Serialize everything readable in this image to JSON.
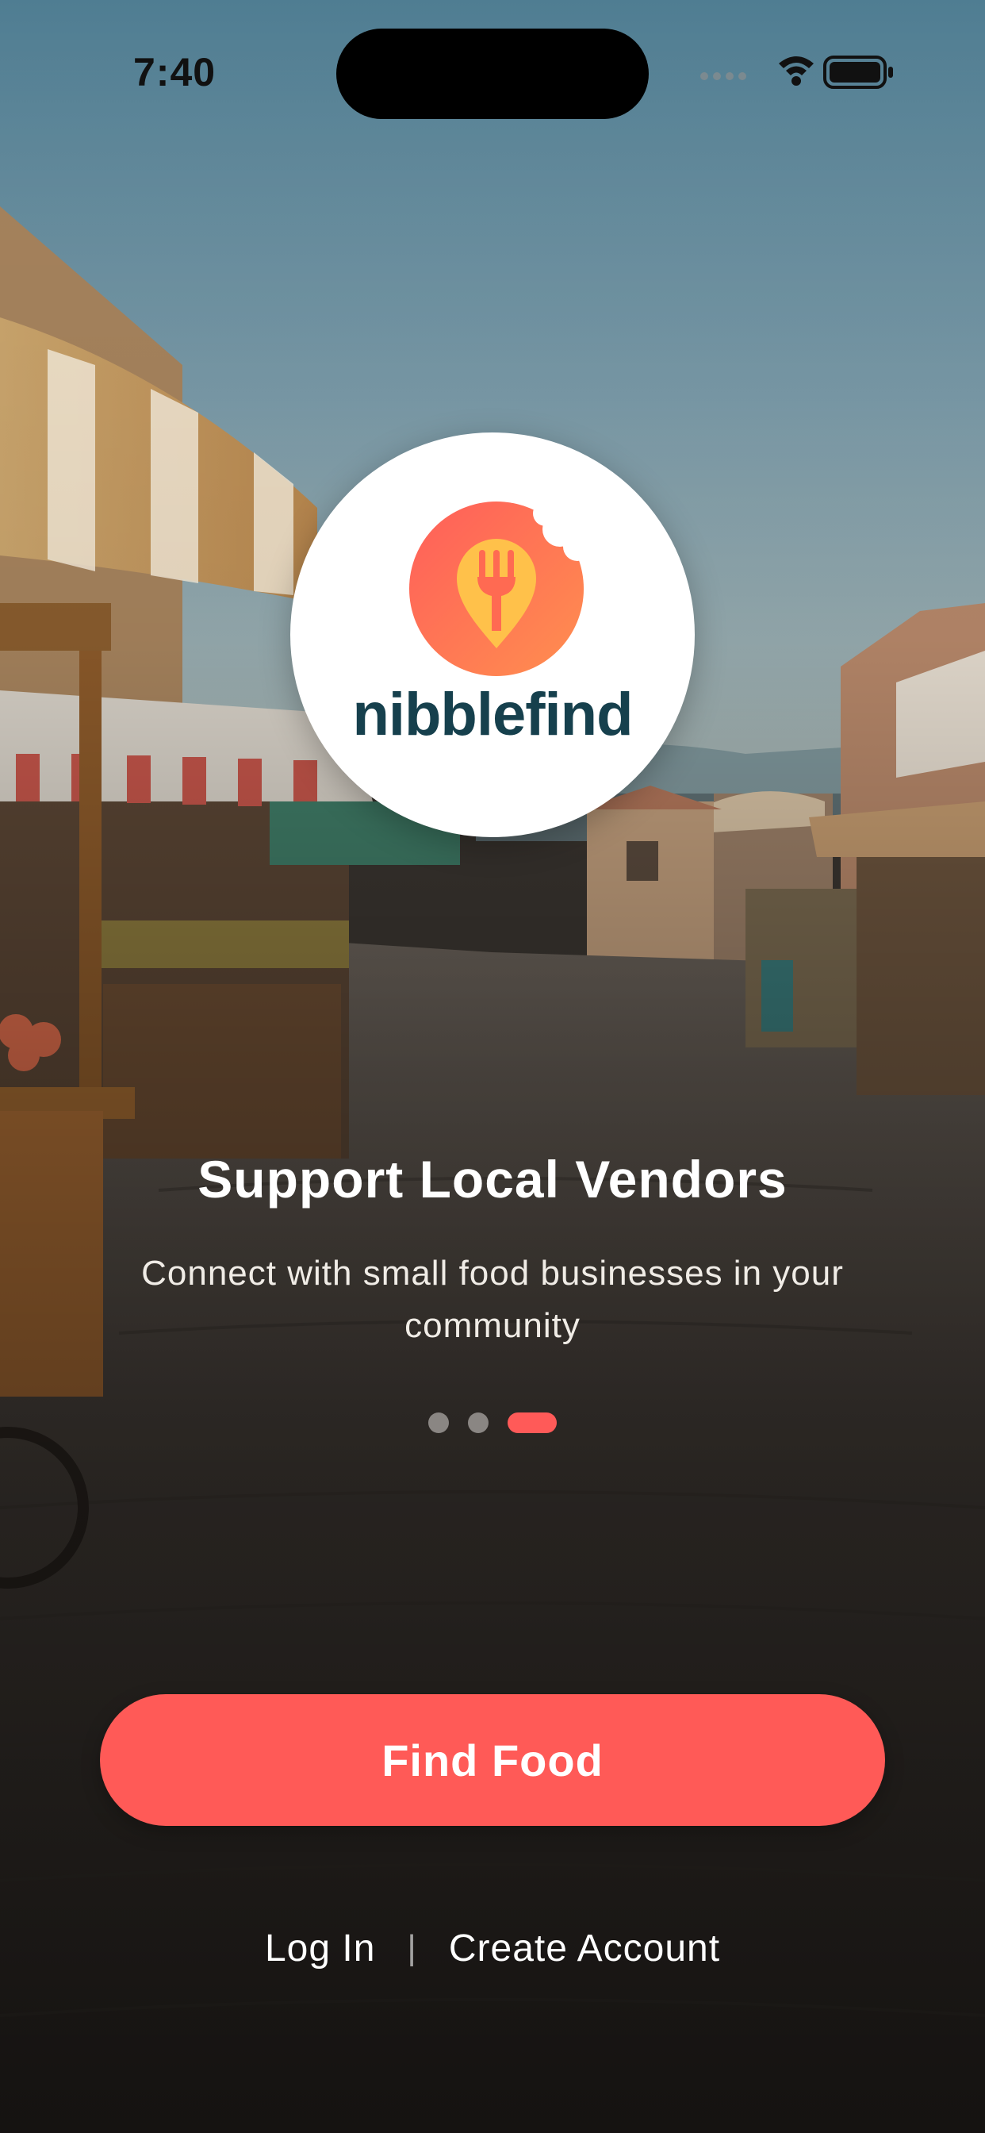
{
  "status_bar": {
    "time": "7:40",
    "icons": [
      "signal-dots-icon",
      "wifi-icon",
      "battery-icon"
    ]
  },
  "logo": {
    "wordmark": "nibblefind",
    "icon": "bitten-circle-fork-pin-icon",
    "colors": {
      "badge": "#ff6b5a",
      "pin": "#ffc14a",
      "wordmark": "#16404d"
    }
  },
  "onboarding": {
    "title": "Support Local Vendors",
    "subtitle": "Connect with small food businesses in your community",
    "pager": {
      "total": 3,
      "current": 3
    }
  },
  "actions": {
    "primary_label": "Find Food",
    "login_label": "Log In",
    "separator": "|",
    "create_account_label": "Create Account"
  },
  "theme": {
    "accent": "#ff5a57",
    "inactive_dot": "#8a8683",
    "text": "#ffffff"
  }
}
